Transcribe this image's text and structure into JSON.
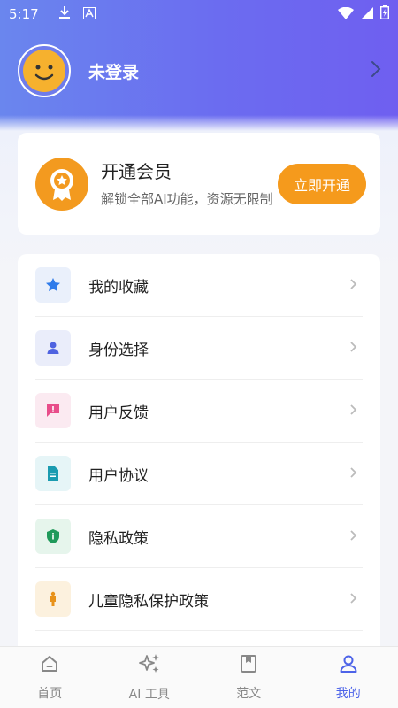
{
  "status_bar": {
    "time": "5:17"
  },
  "profile": {
    "username": "未登录"
  },
  "vip": {
    "title": "开通会员",
    "subtitle": "解锁全部AI功能，资源无限制",
    "button": "立即开通"
  },
  "menu": {
    "items": [
      {
        "label": "我的收藏",
        "icon": "star-icon",
        "color": "#2f7bea",
        "bg": "#eaf0fb"
      },
      {
        "label": "身份选择",
        "icon": "person-icon",
        "color": "#4f63e0",
        "bg": "#eaedfa"
      },
      {
        "label": "用户反馈",
        "icon": "feedback-icon",
        "color": "#e84d8a",
        "bg": "#fbeaf1"
      },
      {
        "label": "用户协议",
        "icon": "document-icon",
        "color": "#1a9bb0",
        "bg": "#e6f5f7"
      },
      {
        "label": "隐私政策",
        "icon": "shield-icon",
        "color": "#1f9a5a",
        "bg": "#e6f5ec"
      },
      {
        "label": "儿童隐私保护政策",
        "icon": "child-icon",
        "color": "#e8921a",
        "bg": "#fcf1de"
      }
    ]
  },
  "tabs": [
    {
      "label": "首页",
      "icon": "home-icon",
      "active": false
    },
    {
      "label": "AI 工具",
      "icon": "sparkle-icon",
      "active": false
    },
    {
      "label": "范文",
      "icon": "book-icon",
      "active": false
    },
    {
      "label": "我的",
      "icon": "user-icon",
      "active": true
    }
  ],
  "colors": {
    "accent": "#4d63e8",
    "vip_orange": "#f59a1c",
    "header_start": "#6a86ee",
    "header_end": "#6f5ff0"
  }
}
